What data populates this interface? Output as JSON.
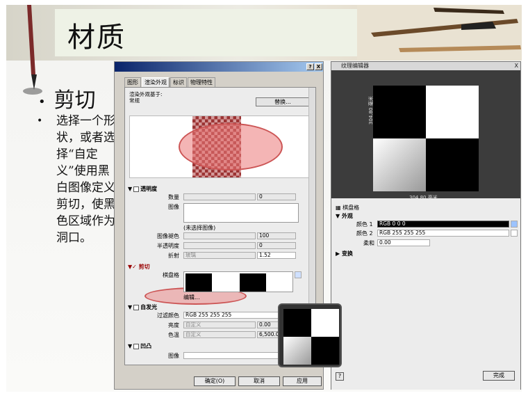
{
  "slide": {
    "title": "材质",
    "bullet_main": "剪切",
    "bullet_sub": "选择一个形状，或者选择“自定义”使用黑白图像定义剪切，使黑色区域作为洞口。"
  },
  "dialog1": {
    "tb_help": "?",
    "tb_close": "X",
    "tabs": [
      "图形",
      "渲染外观",
      "标识",
      "物理特性"
    ],
    "render_based_label": "渲染外观基于:",
    "render_based_value": "常规",
    "replace_button": "替换...",
    "transparency": {
      "title": "透明度",
      "amount_label": "数量",
      "amount_value": "0",
      "image_label": "图像",
      "image_note": "(未选择图像)",
      "fade_label": "图像褪色",
      "fade_value": "100",
      "translucency_label": "半透明度",
      "translucency_value": "0",
      "refraction_label": "折射",
      "refraction_select": "玻璃",
      "refraction_value": "1.52"
    },
    "cutout": {
      "title": "剪切",
      "map_label": "棋盘格",
      "edit_link": "编辑..."
    },
    "self_illum": {
      "title": "自发光",
      "filter_label": "过滤颜色",
      "filter_value": "RGB 255 255 255",
      "lum_label": "亮度",
      "lum_select": "自定义",
      "lum_value": "0.00",
      "temp_label": "色温",
      "temp_select": "自定义",
      "temp_value": "6,500.00"
    },
    "bump": {
      "title": "凹凸",
      "image_label": "图像"
    },
    "ok": "确定(O)",
    "cancel": "取消",
    "apply": "应用"
  },
  "dialog2": {
    "title": "纹理编辑器",
    "close": "X",
    "dim_vertical": "304.80 毫米",
    "dim_horizontal": "304.80 毫米",
    "texture_name": "棋盘格",
    "appearance": "外观",
    "color1_label": "颜色 1",
    "color1_value": "RGB 0 0 0",
    "color2_label": "颜色 2",
    "color2_value": "RGB 255 255 255",
    "soft_label": "柔和",
    "soft_value": "0.00",
    "transform": "变换",
    "help": "?",
    "done": "完成"
  }
}
